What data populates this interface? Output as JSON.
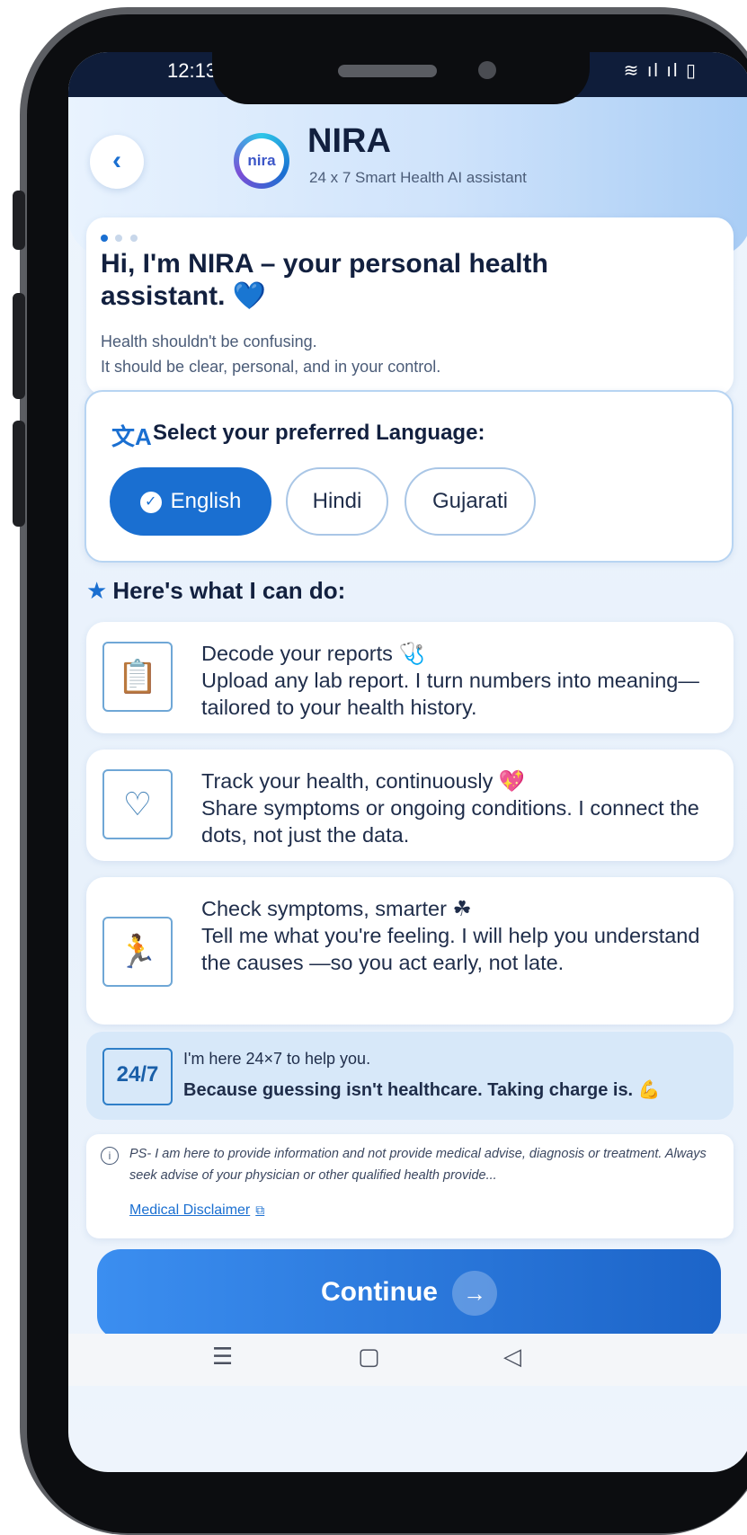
{
  "status_bar": {
    "time": "12:13",
    "icons": "≋ ıl ıl ▯"
  },
  "header": {
    "back_icon": "‹",
    "logo_text": "nira",
    "title": "NIRA",
    "subtitle": "24 x 7 Smart Health AI assistant"
  },
  "intro": {
    "headline": "Hi, I'm NIRA – your personal health assistant.",
    "heart": "💙",
    "line1": "Health shouldn't be confusing.",
    "line2": "It should be clear, personal, and in your control."
  },
  "language": {
    "icon": "文A",
    "title": "Select your preferred Language:",
    "options": [
      "English",
      "Hindi",
      "Gujarati"
    ],
    "selected": "English"
  },
  "capabilities": {
    "title": "Here's what I can do:",
    "items": [
      {
        "title": "Decode your reports 🩺",
        "description": "Upload any lab report. I turn numbers into meaning— tailored to your health history.",
        "icon": "report-icon"
      },
      {
        "title": "Track your health, continuously 💖",
        "description": "Share symptoms or ongoing conditions. I connect the dots, not just the data.",
        "icon": "heart-monitor-icon"
      },
      {
        "title": "Check symptoms, smarter ☘",
        "description": "Tell me what you're feeling. I will help you understand the causes —so you act early, not late.",
        "icon": "running-person-icon"
      }
    ]
  },
  "banner": {
    "badge": "24/7",
    "line1": "I'm here 24×7 to help you.",
    "line2": "Because guessing isn't healthcare. Taking charge is. 💪"
  },
  "disclaimer": {
    "text": "PS- I am here to provide information and not provide medical advise, diagnosis or treatment. Always seek advise of your physician or other qualified health provide...",
    "link": "Medical Disclaimer"
  },
  "continue": {
    "label": "Continue",
    "arrow": "→"
  },
  "colors": {
    "accent": "#1a6fd1",
    "text": "#12203f",
    "banner": "#d7e8f9"
  }
}
